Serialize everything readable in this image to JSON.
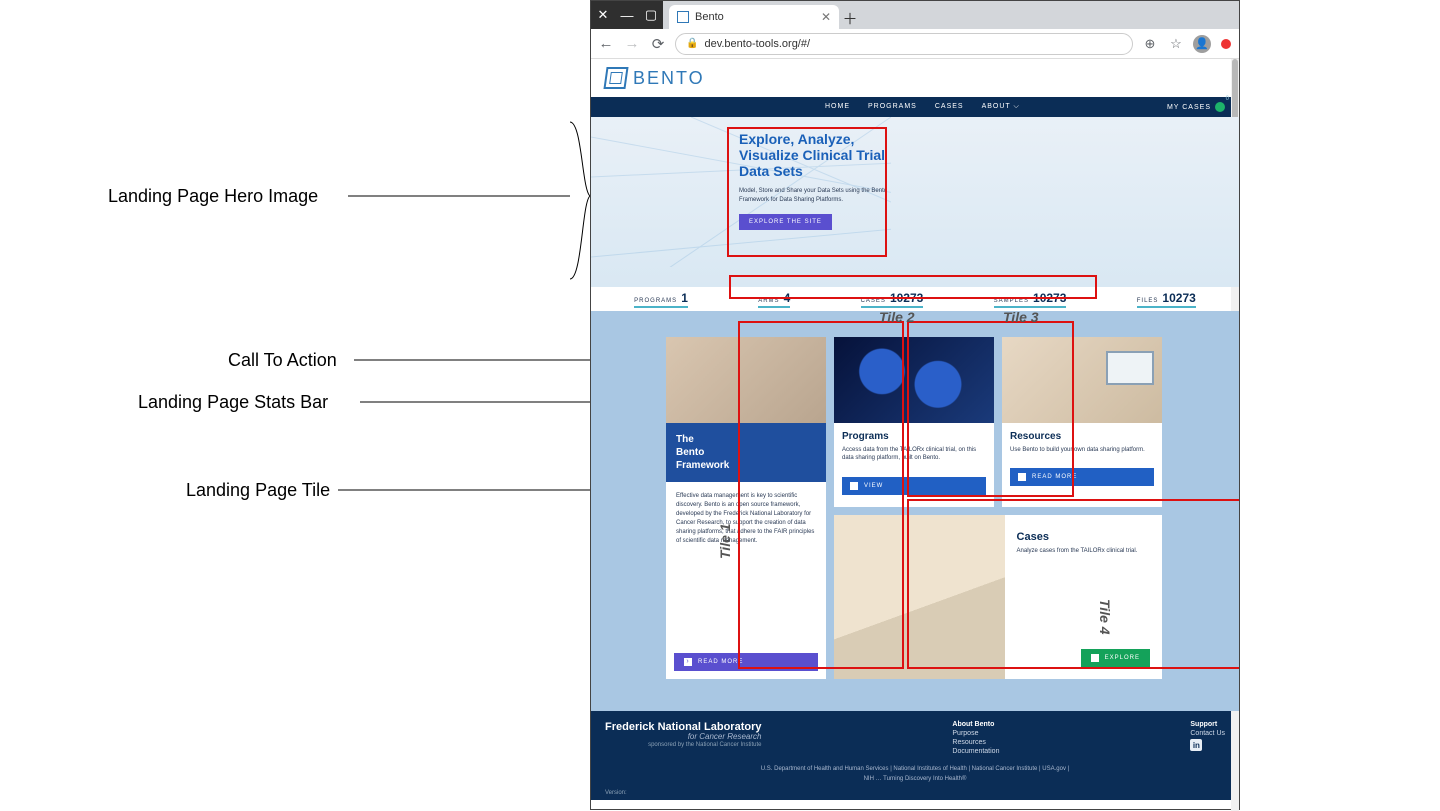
{
  "diagram_labels": {
    "hero": "Landing Page Hero Image",
    "cta": "Call To Action",
    "stats": "Landing Page Stats Bar",
    "tile": "Landing Page Tile"
  },
  "tile_labels": {
    "t1": "Tile 1",
    "t2": "Tile 2",
    "t3": "Tile 3",
    "t4": "Tile 4"
  },
  "browser": {
    "tab_title": "Bento",
    "url": "dev.bento-tools.org/#/"
  },
  "logo": "BENTO",
  "nav": {
    "items": [
      "HOME",
      "PROGRAMS",
      "CASES",
      "ABOUT ⌵"
    ],
    "mycases": "MY CASES"
  },
  "hero": {
    "title": "Explore, Analyze, Visualize Clinical Trial Data Sets",
    "sub": "Model, Store and Share your Data Sets using the Bento Framework for Data Sharing Platforms.",
    "cta": "EXPLORE THE SITE"
  },
  "stats": [
    {
      "lbl": "PROGRAMS",
      "val": "1"
    },
    {
      "lbl": "ARMS",
      "val": "4"
    },
    {
      "lbl": "CASES",
      "val": "10273"
    },
    {
      "lbl": "SAMPLES",
      "val": "10273"
    },
    {
      "lbl": "FILES",
      "val": "10273"
    }
  ],
  "tile1": {
    "heading": "The\nBento\nFramework",
    "desc": "Effective data management is key to scientific discovery. Bento is an open source framework, developed by the Frederick National Laboratory for Cancer Research, to support the creation of data sharing platforms, that adhere to the FAIR principles of scientific data management.",
    "btn": "READ MORE"
  },
  "tile2": {
    "heading": "Programs",
    "desc": "Access data from the TAILORx clinical trial, on this data sharing platform, built on Bento.",
    "btn": "VIEW"
  },
  "tile3": {
    "heading": "Resources",
    "desc": "Use Bento to build your own data sharing platform.",
    "btn": "READ MORE"
  },
  "tile4": {
    "heading": "Cases",
    "desc": "Analyze cases from the TAILORx clinical trial.",
    "btn": "EXPLORE"
  },
  "footer": {
    "fnl1": "Frederick National Laboratory",
    "fnl2": "for Cancer Research",
    "fnl3": "sponsored by the National Cancer Institute",
    "about_h": "About Bento",
    "about": [
      "Purpose",
      "Resources",
      "Documentation"
    ],
    "support_h": "Support",
    "support": [
      "Contact Us"
    ],
    "line1": "U.S. Department of Health and Human Services | National Institutes of Health | National Cancer Institute | USA.gov |",
    "line2": "NIH … Turning Discovery Into Health®",
    "version": "Version:"
  }
}
